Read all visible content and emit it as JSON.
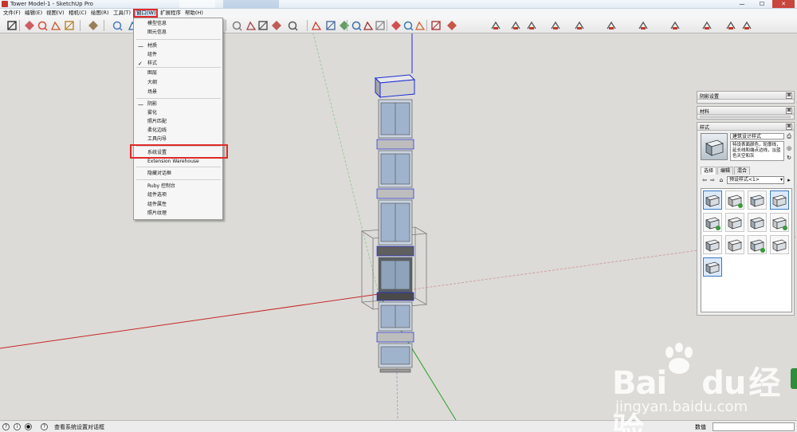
{
  "window": {
    "title": "Tower Model-1 - SketchUp Pro",
    "minimize": "—",
    "maximize": "☐",
    "close": "✕"
  },
  "menubar": {
    "items": [
      {
        "label": "文件(F)"
      },
      {
        "label": "编辑(E)"
      },
      {
        "label": "视图(V)"
      },
      {
        "label": "相机(C)"
      },
      {
        "label": "绘图(R)"
      },
      {
        "label": "工具(T)"
      },
      {
        "label": "窗口(W)"
      },
      {
        "label": "扩展程序"
      },
      {
        "label": "帮助(H)"
      }
    ],
    "active_index": 6
  },
  "window_menu": {
    "items": [
      {
        "label": "模型信息",
        "mark": ""
      },
      {
        "label": "图元信息",
        "mark": ""
      },
      {
        "label": "材质",
        "mark": "—"
      },
      {
        "label": "组件",
        "mark": ""
      },
      {
        "label": "样式",
        "mark": "✓"
      },
      {
        "label": "图层",
        "mark": ""
      },
      {
        "label": "大纲",
        "mark": ""
      },
      {
        "label": "场景",
        "mark": ""
      },
      {
        "label": "阴影",
        "mark": "—"
      },
      {
        "label": "雾化",
        "mark": ""
      },
      {
        "label": "照片匹配",
        "mark": ""
      },
      {
        "label": "柔化边线",
        "mark": ""
      },
      {
        "label": "工具向导",
        "mark": ""
      },
      {
        "label": "系统设置",
        "mark": ""
      },
      {
        "label": "Extension Warehouse",
        "mark": ""
      },
      {
        "label": "隐藏对话框",
        "mark": ""
      },
      {
        "label": "Ruby 控制台",
        "mark": ""
      },
      {
        "label": "组件选项",
        "mark": ""
      },
      {
        "label": "组件属性",
        "mark": ""
      },
      {
        "label": "照片纹理",
        "mark": ""
      }
    ],
    "highlighted": "系统设置"
  },
  "toolbar": {
    "icons": [
      "select-icon",
      "eraser-icon",
      "pencil-icon",
      "arc-icon",
      "paint-bucket-icon",
      "push-pull-icon",
      "orbit-icon",
      "pan-icon",
      "zoom-icon",
      "zoom-extents-icon",
      "section-plane-icon",
      "style-icon",
      "camera-icon",
      "sandbox-icon",
      "shadow-icon",
      "ruler-icon",
      "dimension-icon",
      "protractor-icon",
      "text-icon",
      "axes-icon",
      "3d-text-icon",
      "walk-icon",
      "look-around-icon",
      "position-camera-icon",
      "component-icon",
      "warehouse-icon",
      "share-icon",
      "layout-icon",
      "extension-icon",
      "ruby-icon"
    ]
  },
  "panels": {
    "shadow": {
      "title": "阴影设置",
      "close": "⊠"
    },
    "materials": {
      "title": "材料",
      "close": "⊠"
    },
    "styles": {
      "title": "样式",
      "close": "⊠",
      "style_name": "建筑设计样式",
      "style_description": "特设表面颜色，轮廓线，延长线和端点边线，淡蓝色天空和灰",
      "tabs": [
        "选择",
        "编辑",
        "混合"
      ],
      "selected_tab": "选择",
      "collection": "预设样式<1>",
      "thumbnail_count": 13
    }
  },
  "statusbar": {
    "hint": "查看系统设置对话框",
    "measure_label": "数值",
    "measure_value": ""
  },
  "watermark": {
    "brand": "Bai",
    "brand2": "du",
    "brand_cn": "经验",
    "url": "jingyan.baidu.com"
  },
  "colors": {
    "highlight_red": "#e02a2a",
    "axis_red": "#c62828",
    "axis_green": "#2aa02a",
    "axis_blue": "#2a2ae0",
    "selection_blue": "#1c2cd8",
    "background": "#dcdbd7"
  }
}
